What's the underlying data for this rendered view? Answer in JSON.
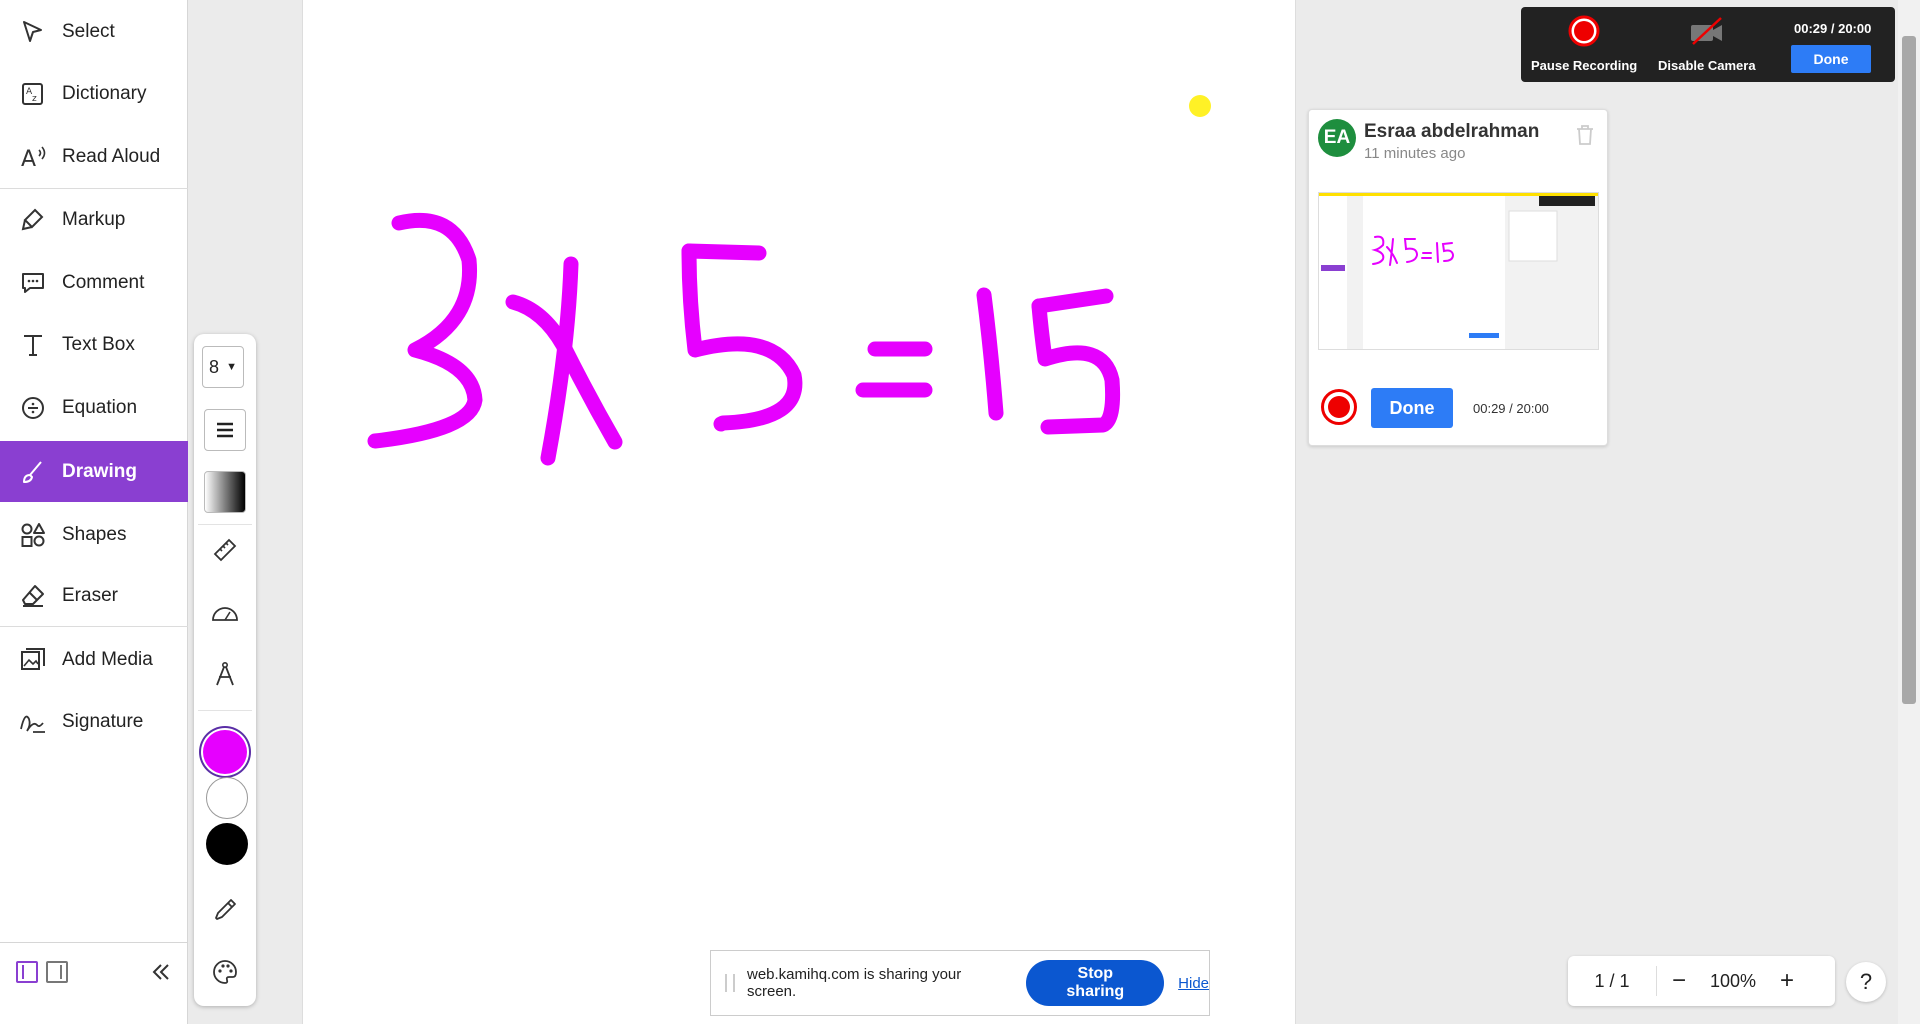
{
  "sidebar": {
    "items": [
      {
        "label": "Select",
        "icon": "cursor-icon"
      },
      {
        "label": "Dictionary",
        "icon": "dictionary-icon"
      },
      {
        "label": "Read Aloud",
        "icon": "read-aloud-icon"
      },
      {
        "label": "Markup",
        "icon": "highlighter-icon"
      },
      {
        "label": "Comment",
        "icon": "comment-icon"
      },
      {
        "label": "Text Box",
        "icon": "text-icon"
      },
      {
        "label": "Equation",
        "icon": "divide-icon"
      },
      {
        "label": "Drawing",
        "icon": "brush-icon",
        "active": true
      },
      {
        "label": "Shapes",
        "icon": "shapes-icon"
      },
      {
        "label": "Eraser",
        "icon": "eraser-icon"
      },
      {
        "label": "Add Media",
        "icon": "media-icon"
      },
      {
        "label": "Signature",
        "icon": "signature-icon"
      }
    ],
    "active_color": "#8a3fd1"
  },
  "palette": {
    "brush_size": "8",
    "swatches": [
      "#e600ff",
      "#ffffff",
      "#000000"
    ],
    "selected_swatch": "#e600ff"
  },
  "drawing": {
    "content": "3x5 = 15",
    "stroke_color": "#e600ff"
  },
  "recording": {
    "pause_label": "Pause Recording",
    "camera_label": "Disable Camera",
    "time": "00:29 / 20:00",
    "done_label": "Done"
  },
  "comment": {
    "avatar_initials": "EA",
    "author": "Esraa abdelrahman",
    "time_ago": "11 minutes ago",
    "done_label": "Done",
    "time": "00:29 / 20:00"
  },
  "share_bar": {
    "message": "web.kamihq.com is sharing your screen.",
    "stop_label": "Stop sharing",
    "hide_label": "Hide"
  },
  "page_controls": {
    "page": "1 / 1",
    "zoom": "100%",
    "minus": "−",
    "plus": "+",
    "help": "?"
  }
}
